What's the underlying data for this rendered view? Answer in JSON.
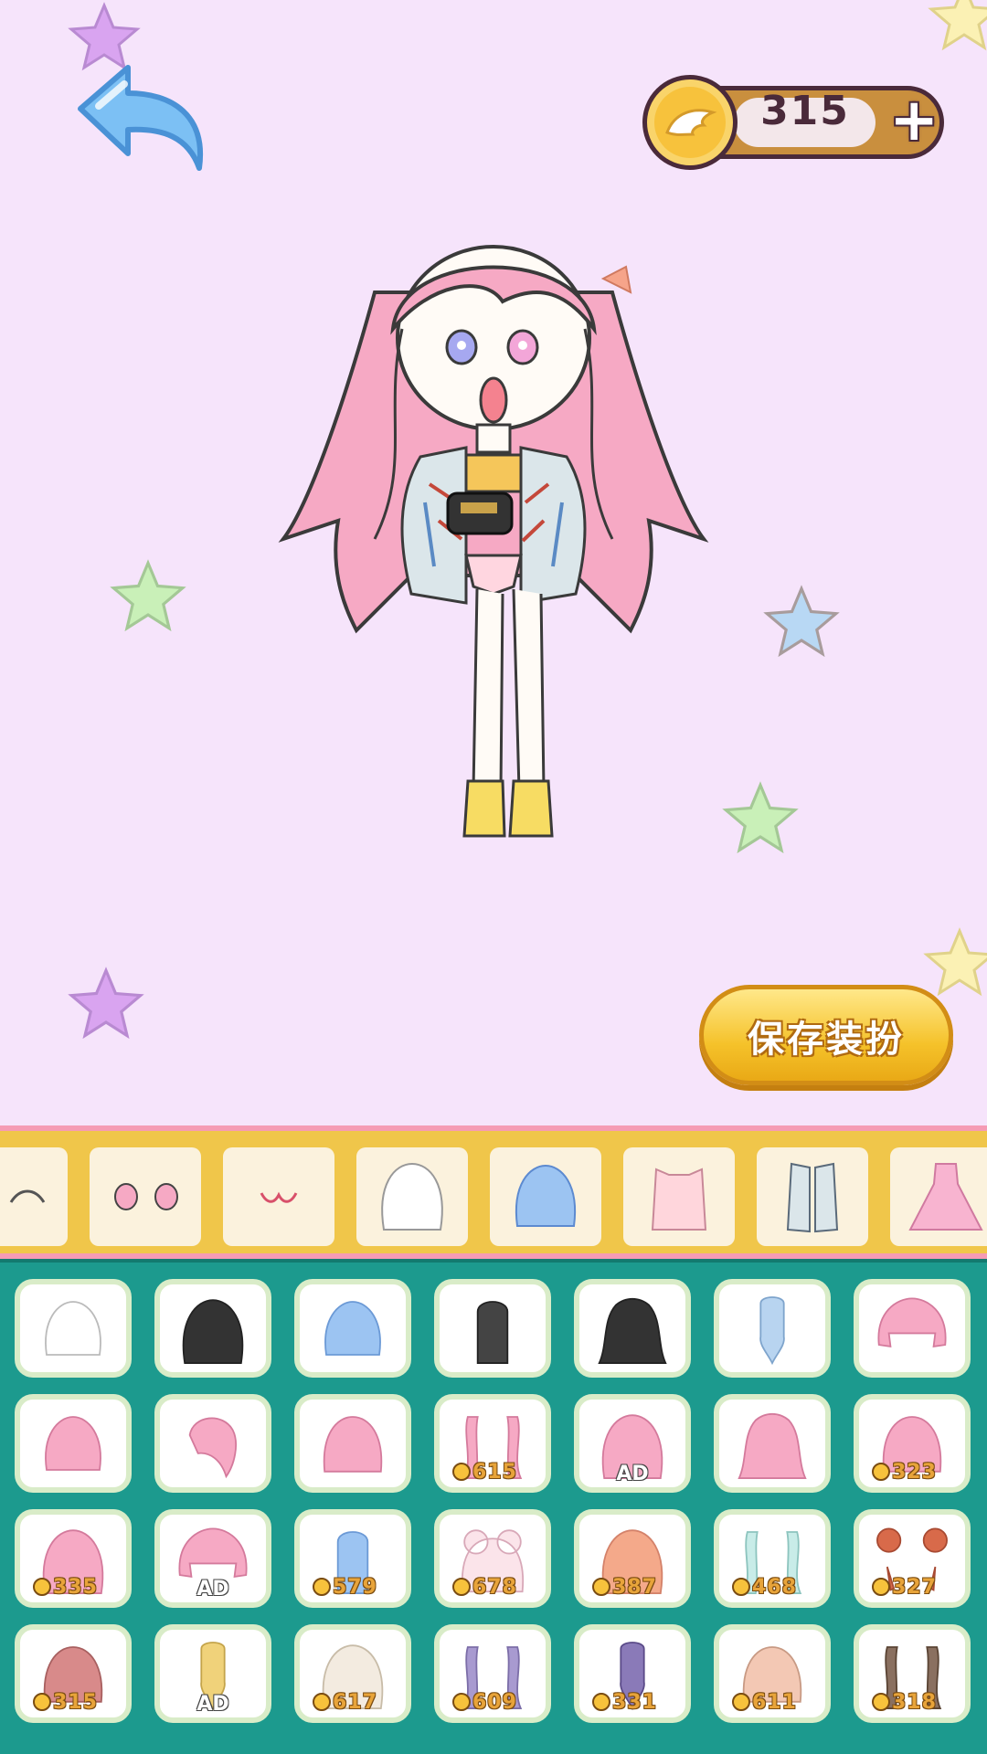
{
  "header": {
    "back_icon": "back-arrow-icon",
    "coins": "315",
    "coin_icon": "wing-coin-icon",
    "add_icon": "plus-icon"
  },
  "save_button": {
    "label": "保存装扮"
  },
  "categories": [
    {
      "name": "eyebrows",
      "icon": "eyebrow-icon"
    },
    {
      "name": "eyes",
      "icon": "eyes-icon"
    },
    {
      "name": "mouth",
      "icon": "mouth-icon"
    },
    {
      "name": "hair-white",
      "icon": "hair-icon"
    },
    {
      "name": "hair-blue",
      "icon": "hair-icon"
    },
    {
      "name": "top",
      "icon": "top-icon"
    },
    {
      "name": "jacket",
      "icon": "jacket-icon"
    },
    {
      "name": "dress",
      "icon": "dress-icon"
    }
  ],
  "items": [
    {
      "color": "#ffffff",
      "stroke": "#bbb",
      "style": "short"
    },
    {
      "color": "#333333",
      "stroke": "#222",
      "style": "long"
    },
    {
      "color": "#9cc4f2",
      "stroke": "#6c9ad6",
      "style": "short"
    },
    {
      "color": "#444444",
      "stroke": "#222",
      "style": "straight"
    },
    {
      "color": "#333333",
      "stroke": "#222",
      "style": "wavy"
    },
    {
      "color": "#b8d4f0",
      "stroke": "#7ea4cc",
      "style": "braid"
    },
    {
      "color": "#f6a9c4",
      "stroke": "#d47a9c",
      "style": "twin"
    },
    {
      "color": "#f6a9c4",
      "stroke": "#d47a9c",
      "style": "short"
    },
    {
      "color": "#f6a9c4",
      "stroke": "#d47a9c",
      "style": "side"
    },
    {
      "color": "#f6a9c4",
      "stroke": "#d47a9c",
      "style": "bob"
    },
    {
      "color": "#f6a9c4",
      "stroke": "#d47a9c",
      "style": "tails",
      "price": "615"
    },
    {
      "color": "#f6a9c4",
      "stroke": "#d47a9c",
      "style": "long",
      "ad": "AD"
    },
    {
      "color": "#f6a9c4",
      "stroke": "#d47a9c",
      "style": "wavy"
    },
    {
      "color": "#f6a9c4",
      "stroke": "#d47a9c",
      "style": "bob",
      "price": "323"
    },
    {
      "color": "#f6a9c4",
      "stroke": "#d47a9c",
      "style": "long",
      "price": "335"
    },
    {
      "color": "#f6a9c4",
      "stroke": "#d47a9c",
      "style": "twin",
      "ad": "AD"
    },
    {
      "color": "#9cc4f2",
      "stroke": "#6c9ad6",
      "style": "straight",
      "price": "579"
    },
    {
      "color": "#fbe4ea",
      "stroke": "#d8a8b8",
      "style": "bun",
      "price": "678"
    },
    {
      "color": "#f4a98a",
      "stroke": "#d4826a",
      "style": "long",
      "price": "387"
    },
    {
      "color": "#c8ece8",
      "stroke": "#8cc4be",
      "style": "tails",
      "price": "468"
    },
    {
      "color": "#d86a4a",
      "stroke": "#a84a32",
      "style": "buns",
      "price": "327"
    },
    {
      "color": "#d88a8a",
      "stroke": "#a86060",
      "style": "bob",
      "price": "315"
    },
    {
      "color": "#f0d27a",
      "stroke": "#c4a44a",
      "style": "braid",
      "ad": "AD"
    },
    {
      "color": "#f3ebe0",
      "stroke": "#c8bca8",
      "style": "long",
      "price": "617"
    },
    {
      "color": "#a89ad0",
      "stroke": "#7c6ea8",
      "style": "tails",
      "price": "609"
    },
    {
      "color": "#8a7ab8",
      "stroke": "#5a4a88",
      "style": "braid",
      "price": "331"
    },
    {
      "color": "#f3c8b4",
      "stroke": "#c89a84",
      "style": "bob",
      "price": "611"
    },
    {
      "color": "#8a7060",
      "stroke": "#5a4434",
      "style": "tails",
      "price": "318"
    }
  ]
}
